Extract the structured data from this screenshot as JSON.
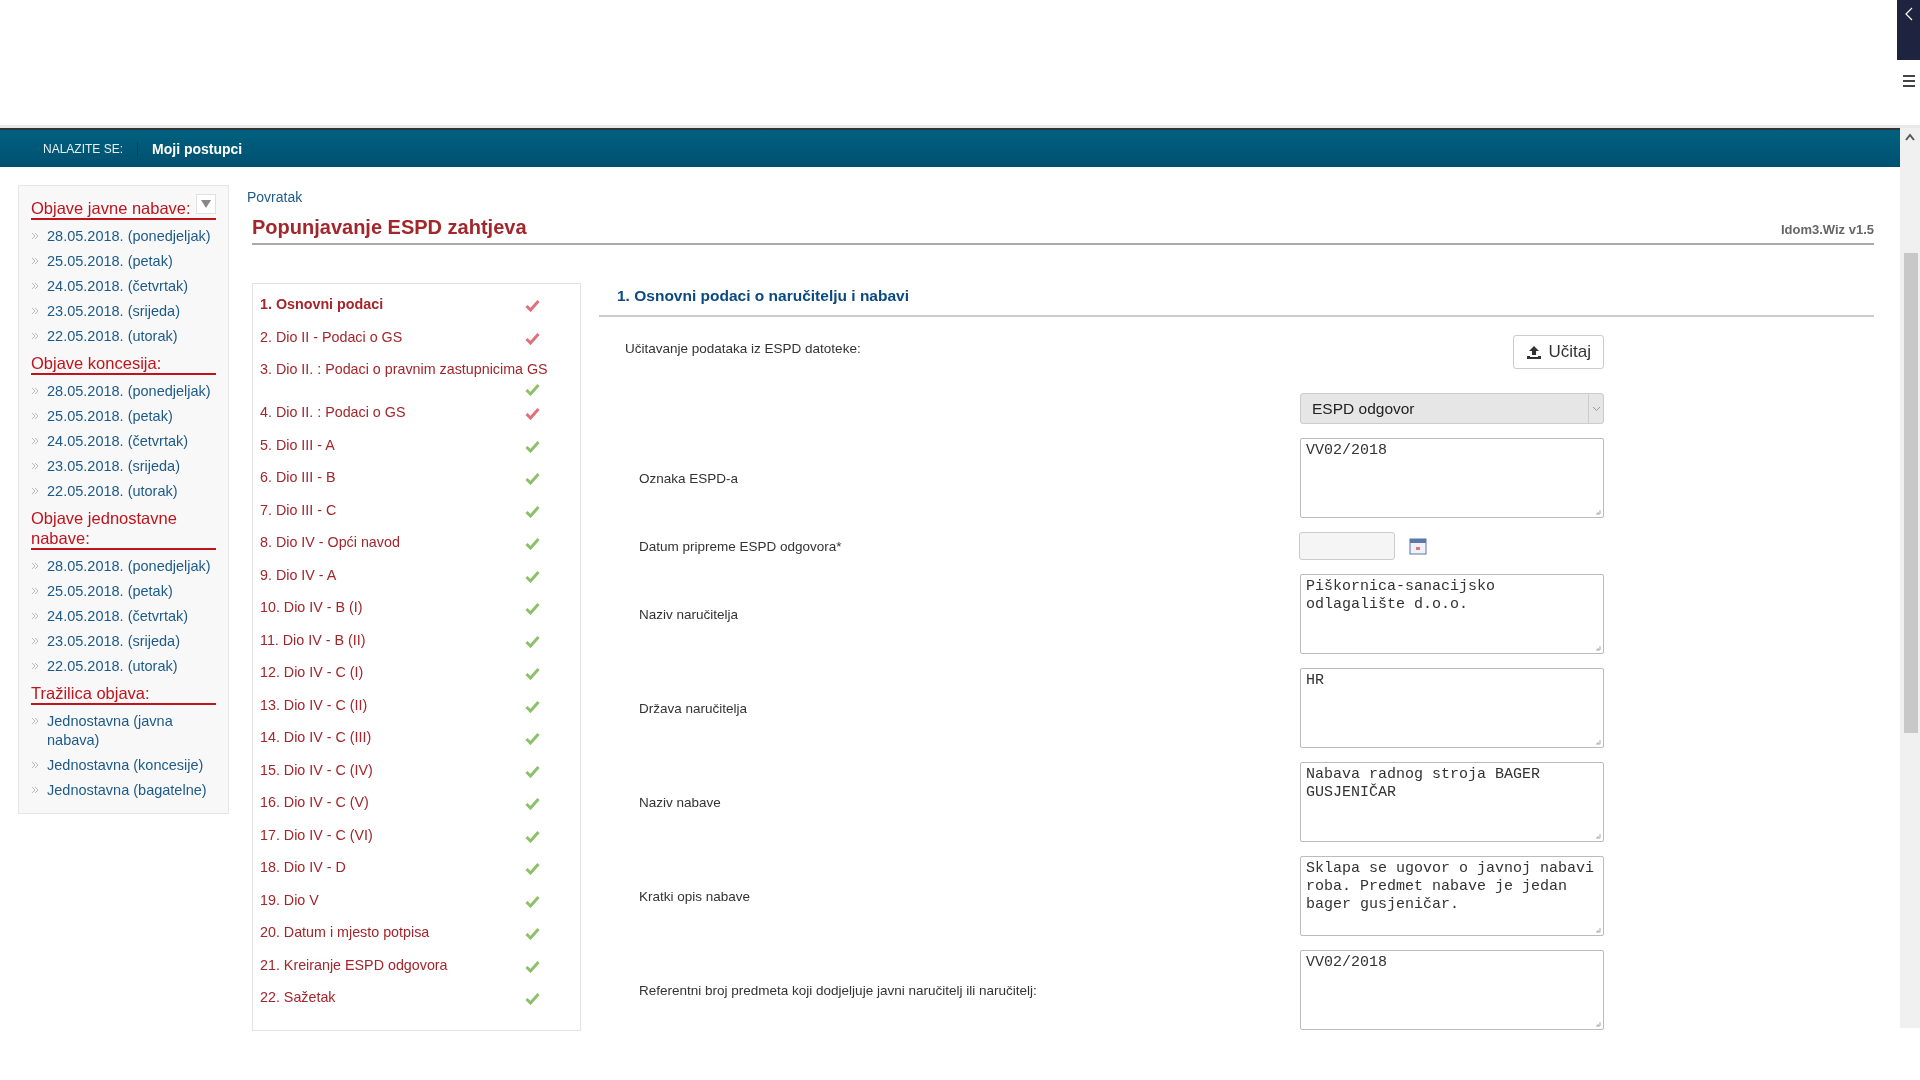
{
  "breadcrumb": {
    "label": "NALAZITE SE:",
    "current": "Moji postupci"
  },
  "sidebar": {
    "sections": [
      {
        "title": "Objave javne nabave:",
        "collapsible": true,
        "items": [
          "28.05.2018. (ponedjeljak)",
          "25.05.2018. (petak)",
          "24.05.2018. (četvrtak)",
          "23.05.2018. (srijeda)",
          "22.05.2018. (utorak)"
        ]
      },
      {
        "title": "Objave koncesija:",
        "collapsible": false,
        "items": [
          "28.05.2018. (ponedjeljak)",
          "25.05.2018. (petak)",
          "24.05.2018. (četvrtak)",
          "23.05.2018. (srijeda)",
          "22.05.2018. (utorak)"
        ]
      },
      {
        "title": "Objave jednostavne nabave:",
        "collapsible": false,
        "items": [
          "28.05.2018. (ponedjeljak)",
          "25.05.2018. (petak)",
          "24.05.2018. (četvrtak)",
          "23.05.2018. (srijeda)",
          "22.05.2018. (utorak)"
        ]
      },
      {
        "title": "Tražilica objava:",
        "collapsible": false,
        "items": [
          "Jednostavna (javna nabava)",
          "Jednostavna (koncesije)",
          "Jednostavna (bagatelne)"
        ]
      }
    ]
  },
  "back_link": "Povratak",
  "page_title": "Popunjavanje ESPD zahtjeva",
  "version": "Idom3.Wiz v1.5",
  "steps": [
    {
      "label": "1. Osnovni podaci",
      "selected": true,
      "valid": false
    },
    {
      "label": "2. Dio II - Podaci o GS",
      "selected": false,
      "valid": false
    },
    {
      "label": "3. Dio II. : Podaci o pravnim zastupnicima GS",
      "selected": false,
      "valid": true
    },
    {
      "label": "4. Dio II. : Podaci o GS",
      "selected": false,
      "valid": false
    },
    {
      "label": "5. Dio III - A",
      "selected": false,
      "valid": true
    },
    {
      "label": "6. Dio III - B",
      "selected": false,
      "valid": true
    },
    {
      "label": "7. Dio III - C",
      "selected": false,
      "valid": true
    },
    {
      "label": "8. Dio IV - Opći navod",
      "selected": false,
      "valid": true
    },
    {
      "label": "9. Dio IV - A",
      "selected": false,
      "valid": true
    },
    {
      "label": "10. Dio IV - B (I)",
      "selected": false,
      "valid": true
    },
    {
      "label": "11. Dio IV - B (II)",
      "selected": false,
      "valid": true
    },
    {
      "label": "12. Dio IV - C (I)",
      "selected": false,
      "valid": true
    },
    {
      "label": "13. Dio IV - C (II)",
      "selected": false,
      "valid": true
    },
    {
      "label": "14. Dio IV - C (III)",
      "selected": false,
      "valid": true
    },
    {
      "label": "15. Dio IV - C (IV)",
      "selected": false,
      "valid": true
    },
    {
      "label": "16. Dio IV - C (V)",
      "selected": false,
      "valid": true
    },
    {
      "label": "17. Dio IV - C (VI)",
      "selected": false,
      "valid": true
    },
    {
      "label": "18. Dio IV - D",
      "selected": false,
      "valid": true
    },
    {
      "label": "19. Dio V",
      "selected": false,
      "valid": true
    },
    {
      "label": "20. Datum i mjesto potpisa",
      "selected": false,
      "valid": true
    },
    {
      "label": "21. Kreiranje ESPD odgovora",
      "selected": false,
      "valid": true
    },
    {
      "label": "22. Sažetak",
      "selected": false,
      "valid": true
    }
  ],
  "form": {
    "heading": "1. Osnovni podaci o naručitelju i nabavi",
    "rows": [
      {
        "kind": "upload",
        "label": "Učitavanje podataka iz ESPD datoteke:",
        "button": "Učitaj"
      },
      {
        "kind": "select",
        "value": "ESPD odgovor"
      },
      {
        "kind": "textarea",
        "label": "Oznaka ESPD-a",
        "value": "VV02/2018"
      },
      {
        "kind": "date",
        "label": "Datum pripreme ESPD odgovora*"
      },
      {
        "kind": "textarea",
        "label": "Naziv naručitelja",
        "value": "Piškornica-sanacijsko odlagalište d.o.o."
      },
      {
        "kind": "textarea",
        "label": "Država naručitelja",
        "value": "HR"
      },
      {
        "kind": "textarea",
        "label": "Naziv nabave",
        "value": "Nabava radnog stroja BAGER GUSJENIČAR"
      },
      {
        "kind": "textarea",
        "label": "Kratki opis nabave",
        "value": "Sklapa se ugovor o javnoj nabavi roba. Predmet nabave je jedan bager gusjeničar."
      },
      {
        "kind": "textarea",
        "label": "Referentni broj predmeta koji dodjeljuje javni naručitelj ili naručitelj:",
        "value": "VV02/2018"
      }
    ]
  }
}
